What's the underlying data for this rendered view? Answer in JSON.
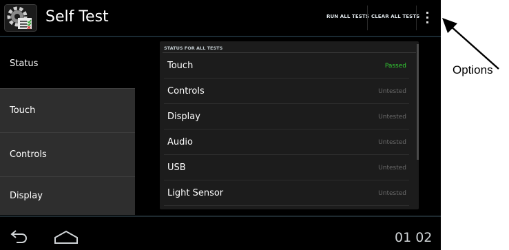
{
  "app": {
    "title": "Self Test",
    "icon": "settings-checklist-icon"
  },
  "actionbar": {
    "run_all_label": "RUN ALL TESTS",
    "clear_all_label": "CLEAR ALL TESTS",
    "overflow_icon": "overflow-menu-icon"
  },
  "sidebar": {
    "items": [
      {
        "label": "Status",
        "active": true
      },
      {
        "label": "Touch",
        "active": false
      },
      {
        "label": "Controls",
        "active": false
      },
      {
        "label": "Display",
        "active": false
      }
    ]
  },
  "panel": {
    "header": "STATUS FOR ALL TESTS",
    "rows": [
      {
        "label": "Touch",
        "status": "Passed"
      },
      {
        "label": "Controls",
        "status": "Untested"
      },
      {
        "label": "Display",
        "status": "Untested"
      },
      {
        "label": "Audio",
        "status": "Untested"
      },
      {
        "label": "USB",
        "status": "Untested"
      },
      {
        "label": "Light Sensor",
        "status": "Untested"
      }
    ]
  },
  "navbar": {
    "back_icon": "back-icon",
    "home_icon": "home-icon",
    "clock": "01 02"
  },
  "callout": {
    "label": "Options"
  },
  "colors": {
    "passed": "#33cc33",
    "untested": "#6a6a6a",
    "accent": "#33b5e5"
  }
}
